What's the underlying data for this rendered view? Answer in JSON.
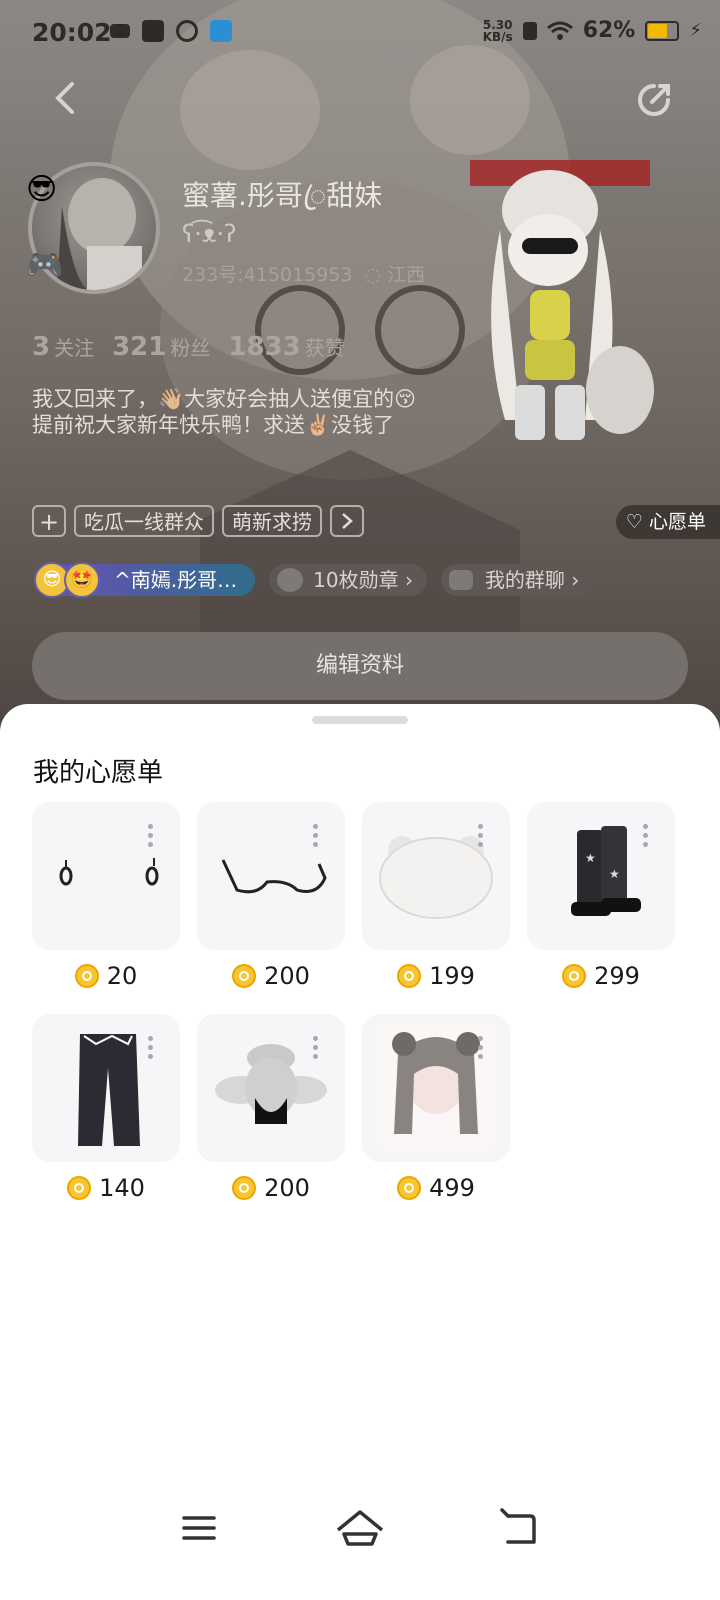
{
  "status_bar": {
    "time": "20:02",
    "speed_value": "5.30",
    "speed_unit": "KB/s",
    "battery": "62%"
  },
  "profile": {
    "nickname": "蜜薯.彤哥ꦿ甜妹",
    "signature": "ʕ·͡ᴥ·ʔ",
    "uid": "233号:415015953",
    "location": "江西",
    "stats": [
      {
        "value": "3",
        "label": "关注"
      },
      {
        "value": "321",
        "label": "粉丝"
      },
      {
        "value": "1833",
        "label": "获赞"
      }
    ],
    "bio": "我又回来了，👋🏼大家好会抽人送便宜的😚\n提前祝大家新年快乐鸭！求送✌🏼没钱了",
    "tags": [
      "吃瓜一线群众",
      "萌新求捞"
    ],
    "wishlist_pill": "心愿单",
    "family_name": "^南嫣.彤哥…",
    "medals": "10枚勋章",
    "groups": "我的群聊",
    "edit_button": "编辑资料"
  },
  "wishlist": {
    "title": "我的心愿单",
    "items": [
      {
        "name": "earrings",
        "price": "20"
      },
      {
        "name": "glasses",
        "price": "200"
      },
      {
        "name": "bear-hat",
        "price": "199"
      },
      {
        "name": "star-boots",
        "price": "299"
      },
      {
        "name": "dark-pants",
        "price": "140"
      },
      {
        "name": "plush-hat",
        "price": "200"
      },
      {
        "name": "hairstyle",
        "price": "499"
      }
    ]
  },
  "colors": {
    "coin": "#f7c52f",
    "sheet_bg": "#ffffff",
    "thumb_bg": "#f6f5f8"
  }
}
